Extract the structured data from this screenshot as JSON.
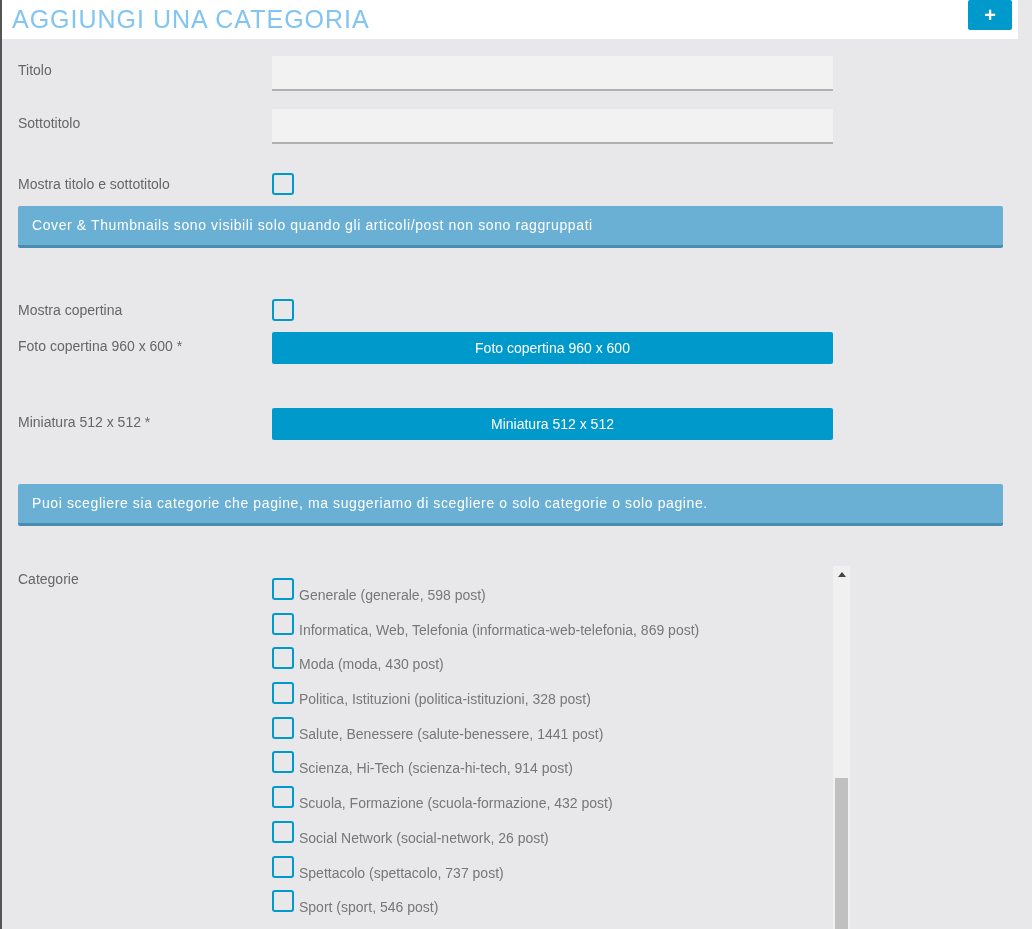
{
  "header": {
    "title": "AGGIUNGI UNA CATEGORIA",
    "add_button": "+"
  },
  "fields": [
    {
      "label": "Titolo",
      "kind": "text"
    },
    {
      "label": "Sottotitolo",
      "kind": "text"
    },
    {
      "label": "Mostra titolo e sottotitolo",
      "kind": "checkbox",
      "checked": false
    },
    {
      "kind": "banner",
      "text": "Cover & Thumbnails sono visibili solo quando gli articoli/post non sono raggruppati"
    },
    {
      "label": "Mostra copertina",
      "kind": "checkbox",
      "checked": false
    },
    {
      "label": "Foto copertina 960 x 600 *",
      "kind": "upload",
      "button": "Foto copertina 960 x 600"
    },
    {
      "label": "Miniatura 512 x 512 *",
      "kind": "upload",
      "button": "Miniatura 512 x 512"
    },
    {
      "kind": "banner",
      "text": "Puoi scegliere sia categorie che pagine, ma suggeriamo di scegliere o solo categorie o solo pagine."
    }
  ],
  "categories": {
    "label": "Categorie",
    "items": [
      {
        "text": "Generale (generale, 598 post)",
        "checked": false
      },
      {
        "text": "Informatica, Web, Telefonia (informatica-web-telefonia, 869 post)",
        "checked": false
      },
      {
        "text": "Moda (moda, 430 post)",
        "checked": false
      },
      {
        "text": "Politica, Istituzioni (politica-istituzioni, 328 post)",
        "checked": false
      },
      {
        "text": "Salute, Benessere (salute-benessere, 1441 post)",
        "checked": false
      },
      {
        "text": "Scienza, Hi-Tech (scienza-hi-tech, 914 post)",
        "checked": false
      },
      {
        "text": "Scuola, Formazione (scuola-formazione, 432 post)",
        "checked": false
      },
      {
        "text": "Social Network (social-network, 26 post)",
        "checked": false
      },
      {
        "text": "Spettacolo (spettacolo, 737 post)",
        "checked": false
      },
      {
        "text": "Sport (sport, 546 post)",
        "checked": false
      }
    ]
  }
}
